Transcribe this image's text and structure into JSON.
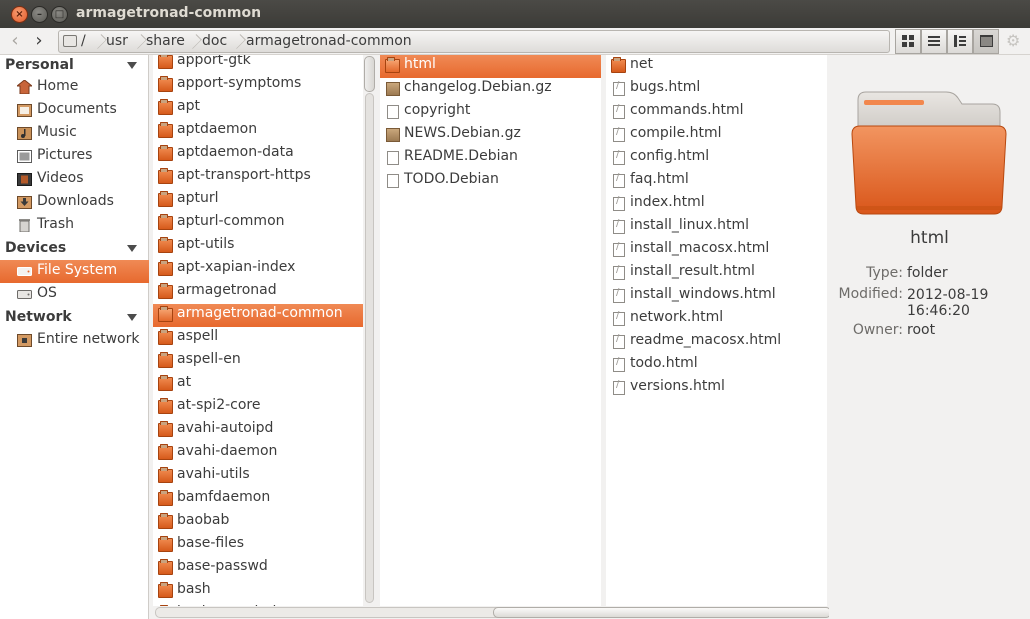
{
  "window": {
    "title": "armagetronad-common"
  },
  "toolbar": {
    "breadcrumbs": [
      "/",
      "usr",
      "share",
      "doc",
      "armagetronad-common"
    ]
  },
  "sidebar": {
    "personal_heading": "Personal",
    "personal_items": [
      "Home",
      "Documents",
      "Music",
      "Pictures",
      "Videos",
      "Downloads",
      "Trash"
    ],
    "devices_heading": "Devices",
    "devices_items": [
      "File System",
      "OS"
    ],
    "network_heading": "Network",
    "network_items": [
      "Entire network"
    ]
  },
  "column1": {
    "items": [
      "apport-gtk",
      "apport-symptoms",
      "apt",
      "aptdaemon",
      "aptdaemon-data",
      "apt-transport-https",
      "apturl",
      "apturl-common",
      "apt-utils",
      "apt-xapian-index",
      "armagetronad",
      "armagetronad-common",
      "aspell",
      "aspell-en",
      "at",
      "at-spi2-core",
      "avahi-autoipd",
      "avahi-daemon",
      "avahi-utils",
      "bamfdaemon",
      "baobab",
      "base-files",
      "base-passwd",
      "bash",
      "bash-completion"
    ],
    "selected_index": 11
  },
  "column2": {
    "items": [
      {
        "name": "html",
        "type": "folder"
      },
      {
        "name": "changelog.Debian.gz",
        "type": "archive"
      },
      {
        "name": "copyright",
        "type": "text"
      },
      {
        "name": "NEWS.Debian.gz",
        "type": "archive"
      },
      {
        "name": "README.Debian",
        "type": "text"
      },
      {
        "name": "TODO.Debian",
        "type": "text"
      }
    ],
    "selected_index": 0
  },
  "column3": {
    "items": [
      {
        "name": "net",
        "type": "folder"
      },
      {
        "name": "bugs.html",
        "type": "html"
      },
      {
        "name": "commands.html",
        "type": "html"
      },
      {
        "name": "compile.html",
        "type": "html"
      },
      {
        "name": "config.html",
        "type": "html"
      },
      {
        "name": "faq.html",
        "type": "html"
      },
      {
        "name": "index.html",
        "type": "html"
      },
      {
        "name": "install_linux.html",
        "type": "html"
      },
      {
        "name": "install_macosx.html",
        "type": "html"
      },
      {
        "name": "install_result.html",
        "type": "html"
      },
      {
        "name": "install_windows.html",
        "type": "html"
      },
      {
        "name": "network.html",
        "type": "html"
      },
      {
        "name": "readme_macosx.html",
        "type": "html"
      },
      {
        "name": "todo.html",
        "type": "html"
      },
      {
        "name": "versions.html",
        "type": "html"
      }
    ]
  },
  "preview": {
    "name": "html",
    "type_label": "Type:",
    "type_value": "folder",
    "modified_label": "Modified:",
    "modified_date": "2012-08-19",
    "modified_time": "16:46:20",
    "owner_label": "Owner:",
    "owner_value": "root"
  },
  "icons": {
    "folder": "folder-icon",
    "archive": "archive-icon",
    "text": "text-file-icon",
    "html": "html-file-icon"
  },
  "colors": {
    "accent": "#e7692e",
    "titlebar": "#3c3b37"
  }
}
